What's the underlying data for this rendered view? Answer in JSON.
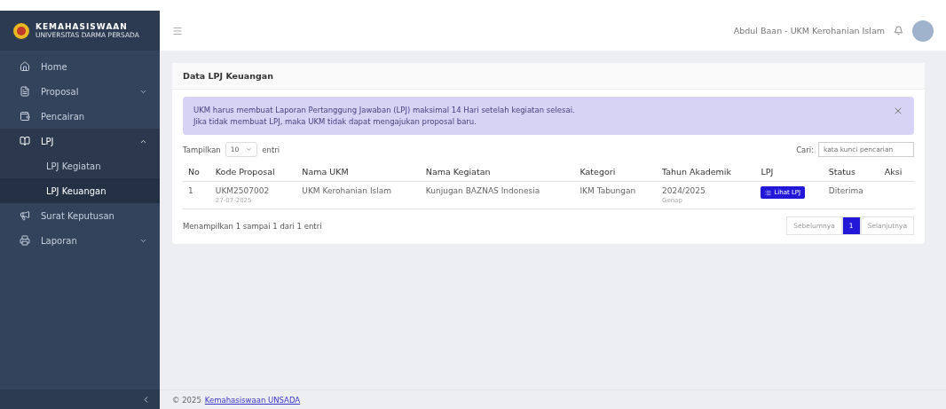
{
  "brand": {
    "title": "KEMAHASISWAAN",
    "subtitle": "UNIVERSITAS DARMA PERSADA"
  },
  "sidebar": {
    "items": [
      {
        "label": "Home",
        "selected": false
      },
      {
        "label": "Proposal",
        "selected": false,
        "expanded": false
      },
      {
        "label": "Pencairan",
        "selected": false
      },
      {
        "label": "LPJ",
        "selected": true,
        "expanded": true,
        "children": [
          {
            "label": "LPJ Kegiatan",
            "selected": false
          },
          {
            "label": "LPJ Keuangan",
            "selected": true
          }
        ]
      },
      {
        "label": "Surat Keputusan",
        "selected": false
      },
      {
        "label": "Laporan",
        "selected": false,
        "expanded": false
      }
    ]
  },
  "header": {
    "user": "Abdul Baan - UKM Kerohanian Islam"
  },
  "card": {
    "title": "Data LPJ Keuangan",
    "alert": [
      "UKM harus membuat Laporan Pertanggung Jawaban (LPJ) maksimal 14 Hari setelah kegiatan selesai.",
      "Jika tidak membuat LPJ, maka UKM tidak dapat mengajukan proposal baru."
    ],
    "length_prefix": "Tampilkan",
    "length_value": "10",
    "length_suffix": "entri",
    "search_label": "Cari:",
    "search_placeholder": "kata kunci pencarian",
    "table": {
      "columns": [
        "No",
        "Kode Proposal",
        "Nama UKM",
        "Nama Kegiatan",
        "Kategori",
        "Tahun Akademik",
        "LPJ",
        "Status",
        "Aksi"
      ],
      "rows": [
        {
          "no": "1",
          "kode": "UKM2507002",
          "tanggal": "27-07-2025",
          "ukm": "UKM Kerohanian Islam",
          "kegiatan": "Kunjugan BAZNAS Indonesia",
          "kategori": "IKM Tabungan",
          "tahun": "2024/2025",
          "semester": "Genap",
          "lpj_button": "Lihat LPJ",
          "status": "Diterima"
        }
      ]
    },
    "info": "Menampilkan 1 sampai 1 dari 1 entri",
    "pagination": [
      {
        "label": "Sebelumnya",
        "selected": false
      },
      {
        "label": "1",
        "selected": true
      },
      {
        "label": "Selanjutnya",
        "selected": false
      }
    ]
  },
  "footer": {
    "copyright": "© 2025",
    "link": "Kemahasiswaan UNSADA"
  }
}
